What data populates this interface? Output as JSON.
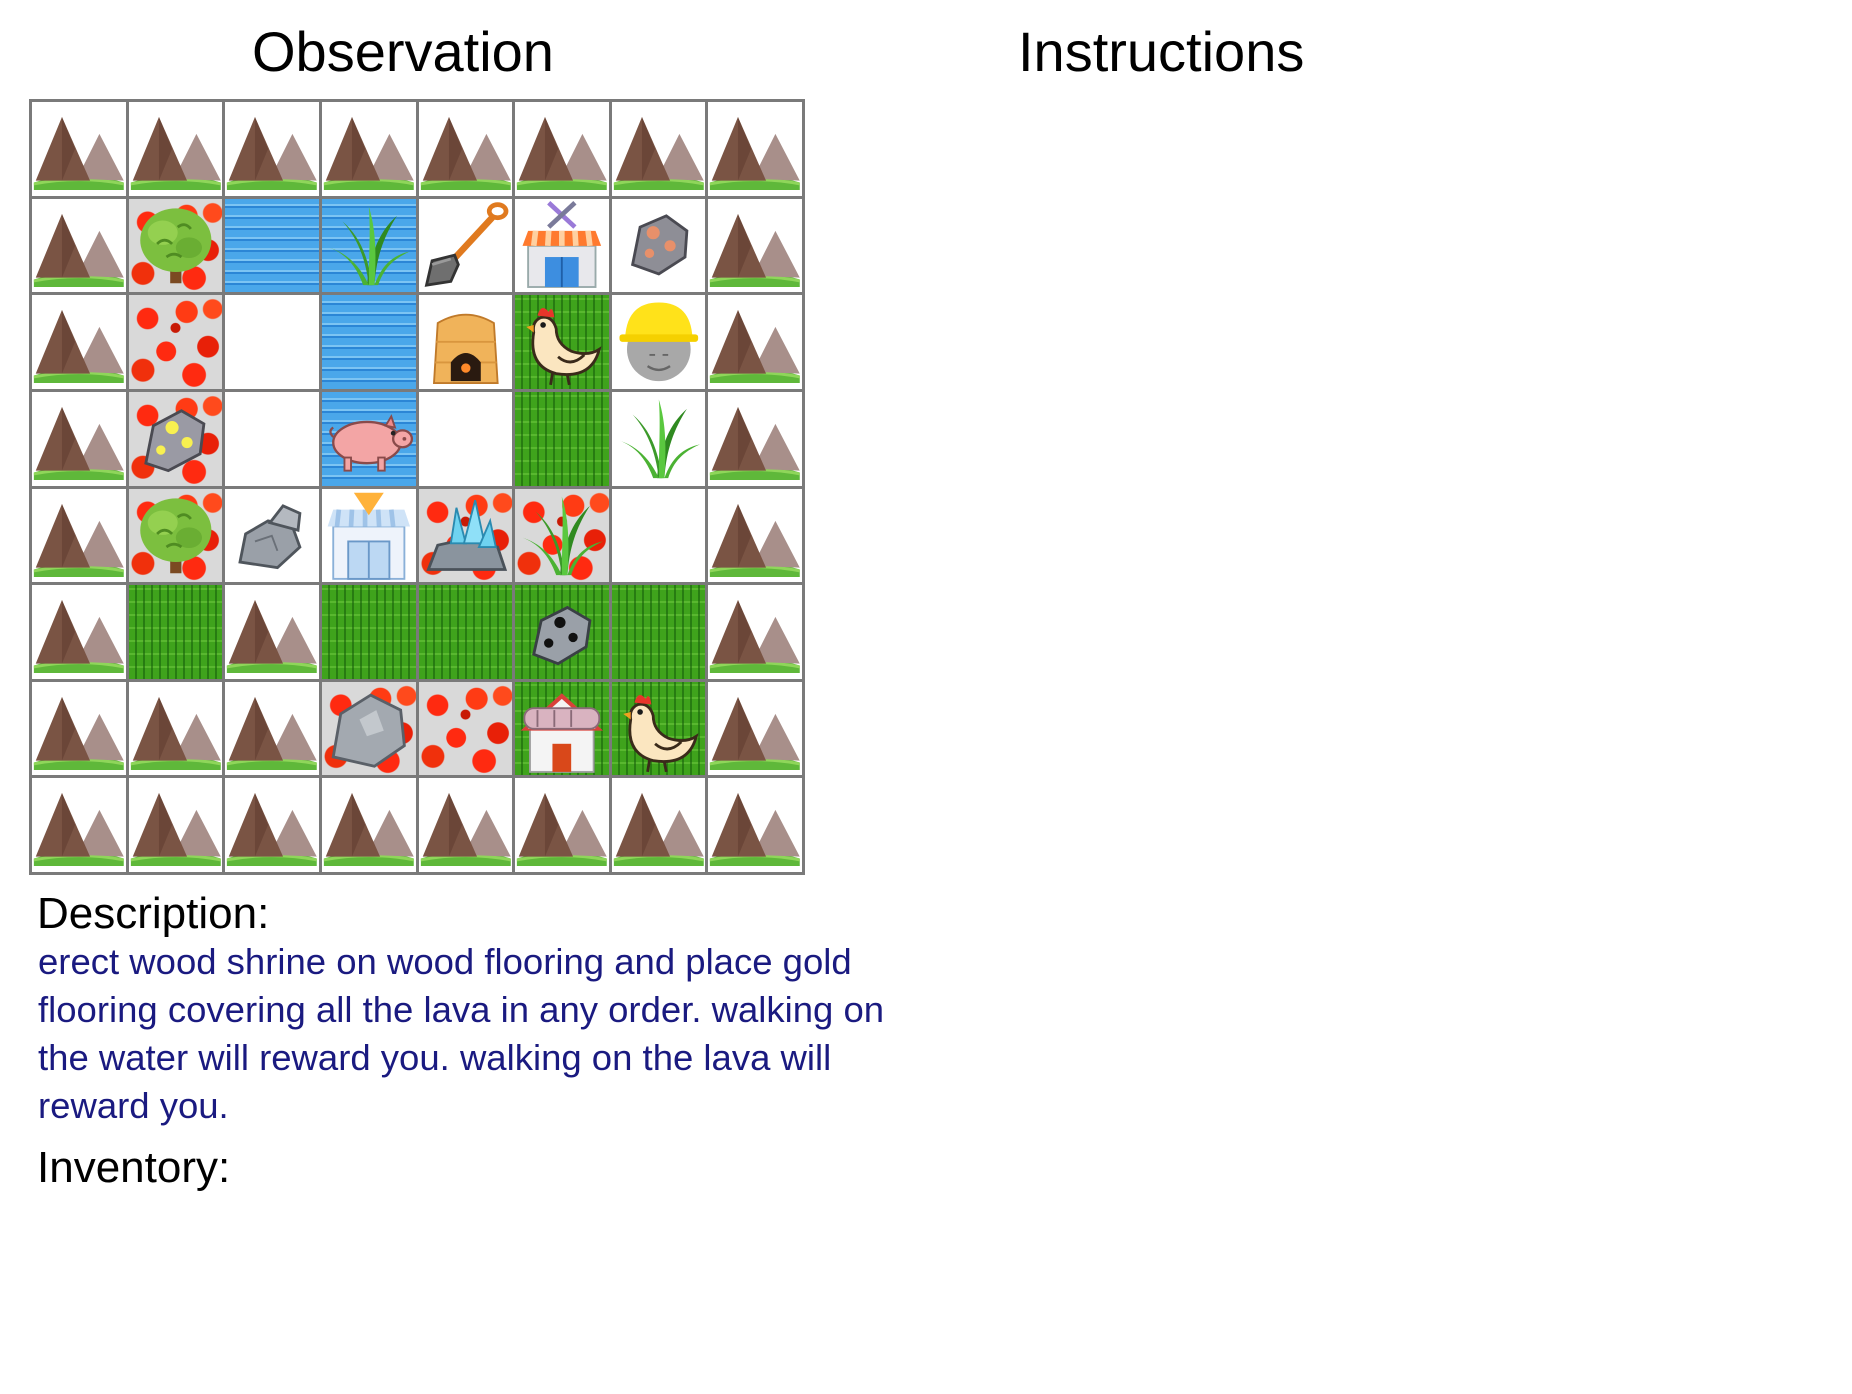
{
  "headings": {
    "observation": "Observation",
    "instructions": "Instructions"
  },
  "description": {
    "label": "Description:",
    "text": "erect wood shrine on wood flooring and place gold flooring covering all the lava in any order. walking on the water will reward you. walking on the lava will reward you."
  },
  "inventory": {
    "label": "Inventory:",
    "items": []
  },
  "grid": {
    "rows": 8,
    "cols": 8,
    "cells": [
      [
        {
          "bg": "none",
          "obj": "mountain"
        },
        {
          "bg": "none",
          "obj": "mountain"
        },
        {
          "bg": "none",
          "obj": "mountain"
        },
        {
          "bg": "none",
          "obj": "mountain"
        },
        {
          "bg": "none",
          "obj": "mountain"
        },
        {
          "bg": "none",
          "obj": "mountain"
        },
        {
          "bg": "none",
          "obj": "mountain"
        },
        {
          "bg": "none",
          "obj": "mountain"
        }
      ],
      [
        {
          "bg": "none",
          "obj": "mountain"
        },
        {
          "bg": "lava",
          "obj": "tree"
        },
        {
          "bg": "water",
          "obj": "none"
        },
        {
          "bg": "water",
          "obj": "grass-tuft"
        },
        {
          "bg": "none",
          "obj": "shovel"
        },
        {
          "bg": "none",
          "obj": "workshop"
        },
        {
          "bg": "none",
          "obj": "iron-ore"
        },
        {
          "bg": "none",
          "obj": "mountain"
        }
      ],
      [
        {
          "bg": "none",
          "obj": "mountain"
        },
        {
          "bg": "lava",
          "obj": "none"
        },
        {
          "bg": "none",
          "obj": "none"
        },
        {
          "bg": "water",
          "obj": "none"
        },
        {
          "bg": "none",
          "obj": "furnace"
        },
        {
          "bg": "grass",
          "obj": "chicken"
        },
        {
          "bg": "none",
          "obj": "player"
        },
        {
          "bg": "none",
          "obj": "mountain"
        }
      ],
      [
        {
          "bg": "none",
          "obj": "mountain"
        },
        {
          "bg": "lava",
          "obj": "gold-ore"
        },
        {
          "bg": "none",
          "obj": "none"
        },
        {
          "bg": "water",
          "obj": "pig"
        },
        {
          "bg": "none",
          "obj": "none"
        },
        {
          "bg": "grass",
          "obj": "none"
        },
        {
          "bg": "none",
          "obj": "grass-tuft"
        },
        {
          "bg": "none",
          "obj": "mountain"
        }
      ],
      [
        {
          "bg": "none",
          "obj": "mountain"
        },
        {
          "bg": "lava",
          "obj": "tree"
        },
        {
          "bg": "none",
          "obj": "stone"
        },
        {
          "bg": "none",
          "obj": "gem-shop"
        },
        {
          "bg": "lava",
          "obj": "crystal"
        },
        {
          "bg": "lava",
          "obj": "grass-tuft"
        },
        {
          "bg": "none",
          "obj": "none"
        },
        {
          "bg": "none",
          "obj": "mountain"
        }
      ],
      [
        {
          "bg": "none",
          "obj": "mountain"
        },
        {
          "bg": "grass",
          "obj": "none"
        },
        {
          "bg": "none",
          "obj": "mountain"
        },
        {
          "bg": "grass",
          "obj": "none"
        },
        {
          "bg": "grass",
          "obj": "none"
        },
        {
          "bg": "grass",
          "obj": "coal"
        },
        {
          "bg": "grass",
          "obj": "none"
        },
        {
          "bg": "none",
          "obj": "mountain"
        }
      ],
      [
        {
          "bg": "none",
          "obj": "mountain"
        },
        {
          "bg": "none",
          "obj": "mountain"
        },
        {
          "bg": "none",
          "obj": "mountain"
        },
        {
          "bg": "lava",
          "obj": "boulder"
        },
        {
          "bg": "lava",
          "obj": "none"
        },
        {
          "bg": "grass",
          "obj": "house"
        },
        {
          "bg": "grass",
          "obj": "chicken"
        },
        {
          "bg": "none",
          "obj": "mountain"
        }
      ],
      [
        {
          "bg": "none",
          "obj": "mountain"
        },
        {
          "bg": "none",
          "obj": "mountain"
        },
        {
          "bg": "none",
          "obj": "mountain"
        },
        {
          "bg": "none",
          "obj": "mountain"
        },
        {
          "bg": "none",
          "obj": "mountain"
        },
        {
          "bg": "none",
          "obj": "mountain"
        },
        {
          "bg": "none",
          "obj": "mountain"
        },
        {
          "bg": "none",
          "obj": "mountain"
        }
      ]
    ]
  }
}
